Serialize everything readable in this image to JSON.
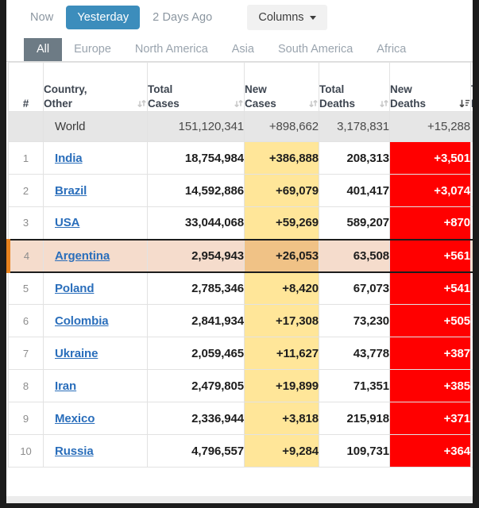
{
  "toolbar": {
    "buttons": [
      {
        "label": "Now",
        "active": false
      },
      {
        "label": "Yesterday",
        "active": true
      },
      {
        "label": "2 Days Ago",
        "active": false
      }
    ],
    "columns_label": "Columns"
  },
  "regions": {
    "tabs": [
      {
        "label": "All",
        "active": true
      },
      {
        "label": "Europe",
        "active": false
      },
      {
        "label": "North America",
        "active": false
      },
      {
        "label": "Asia",
        "active": false
      },
      {
        "label": "South America",
        "active": false
      },
      {
        "label": "Africa",
        "active": false
      }
    ]
  },
  "table": {
    "headers": [
      {
        "line1": "",
        "line2": "#",
        "sort": "none"
      },
      {
        "line1": "Country,",
        "line2": "Other",
        "sort": "both"
      },
      {
        "line1": "Total",
        "line2": "Cases",
        "sort": "both"
      },
      {
        "line1": "New",
        "line2": "Cases",
        "sort": "both"
      },
      {
        "line1": "Total",
        "line2": "Deaths",
        "sort": "both"
      },
      {
        "line1": "New",
        "line2": "Deaths",
        "sort": "desc"
      },
      {
        "line1": "T",
        "line2": "R",
        "sort": "none"
      }
    ],
    "world_row": {
      "index": "",
      "country": "World",
      "total_cases": "151,120,341",
      "new_cases": "+898,662",
      "total_deaths": "3,178,831",
      "new_deaths": "+15,288"
    },
    "rows": [
      {
        "index": "1",
        "country": "India",
        "total_cases": "18,754,984",
        "new_cases": "+386,888",
        "total_deaths": "208,313",
        "new_deaths": "+3,501",
        "highlighted": false
      },
      {
        "index": "2",
        "country": "Brazil",
        "total_cases": "14,592,886",
        "new_cases": "+69,079",
        "total_deaths": "401,417",
        "new_deaths": "+3,074",
        "highlighted": false
      },
      {
        "index": "3",
        "country": "USA",
        "total_cases": "33,044,068",
        "new_cases": "+59,269",
        "total_deaths": "589,207",
        "new_deaths": "+870",
        "highlighted": false
      },
      {
        "index": "4",
        "country": "Argentina",
        "total_cases": "2,954,943",
        "new_cases": "+26,053",
        "total_deaths": "63,508",
        "new_deaths": "+561",
        "highlighted": true
      },
      {
        "index": "5",
        "country": "Poland",
        "total_cases": "2,785,346",
        "new_cases": "+8,420",
        "total_deaths": "67,073",
        "new_deaths": "+541",
        "highlighted": false
      },
      {
        "index": "6",
        "country": "Colombia",
        "total_cases": "2,841,934",
        "new_cases": "+17,308",
        "total_deaths": "73,230",
        "new_deaths": "+505",
        "highlighted": false
      },
      {
        "index": "7",
        "country": "Ukraine",
        "total_cases": "2,059,465",
        "new_cases": "+11,627",
        "total_deaths": "43,778",
        "new_deaths": "+387",
        "highlighted": false
      },
      {
        "index": "8",
        "country": "Iran",
        "total_cases": "2,479,805",
        "new_cases": "+19,899",
        "total_deaths": "71,351",
        "new_deaths": "+385",
        "highlighted": false
      },
      {
        "index": "9",
        "country": "Mexico",
        "total_cases": "2,336,944",
        "new_cases": "+3,818",
        "total_deaths": "215,918",
        "new_deaths": "+371",
        "highlighted": false
      },
      {
        "index": "10",
        "country": "Russia",
        "total_cases": "4,796,557",
        "new_cases": "+9,284",
        "total_deaths": "109,731",
        "new_deaths": "+364",
        "highlighted": false
      }
    ]
  },
  "colors": {
    "accent_blue": "#3c8dbc",
    "tab_active_gray": "#6d7b85",
    "new_cases_yellow": "#ffe699",
    "new_deaths_red": "#ff0000",
    "highlight_row": "#f5dccc",
    "highlight_border": "#e8821e",
    "link_blue": "#2a6ebb"
  }
}
